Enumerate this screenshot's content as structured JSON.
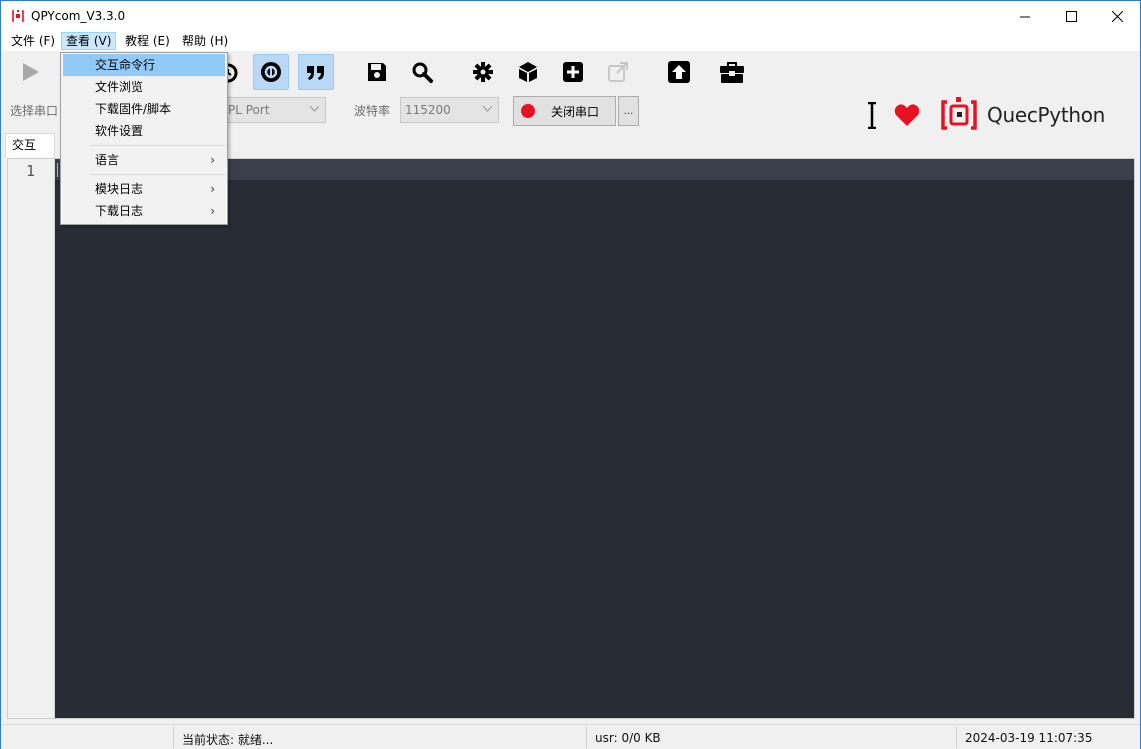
{
  "window": {
    "title": "QPYcom_V3.3.0"
  },
  "menubar": {
    "items": [
      {
        "label": "文件 (F)"
      },
      {
        "label": "查看 (V)"
      },
      {
        "label": "教程 (E)"
      },
      {
        "label": "帮助 (H)"
      }
    ]
  },
  "view_menu": {
    "items": [
      {
        "label": "交互命令行",
        "highlighted": true
      },
      {
        "label": "文件浏览"
      },
      {
        "label": "下载固件/脚本"
      },
      {
        "label": "软件设置"
      },
      {
        "label": "语言",
        "submenu": true
      },
      {
        "label": "模块日志",
        "submenu": true
      },
      {
        "label": "下载日志",
        "submenu": true
      }
    ],
    "submenu_arrow": "›"
  },
  "toolbar": {
    "icons": [
      "run-icon",
      "alarm-icon",
      "python-icon",
      "quote-icon",
      "save-icon",
      "search-icon",
      "settings-icon",
      "cube-icon",
      "plus-icon",
      "external-link-icon",
      "upload-icon",
      "toolbox-icon"
    ],
    "port_label": "选择串口",
    "port_value": "REPL Port",
    "port_value_visible": "PL Port",
    "baud_label": "波特率",
    "baud_value": "115200",
    "port_button_label": "关闭串口",
    "more_button_label": "...",
    "brand_text": "QuecPython",
    "colors": {
      "accent": "#e81123",
      "toggled": "#b7d9f5"
    }
  },
  "tabs": [
    {
      "label": "交互"
    }
  ],
  "editor": {
    "line_numbers": [
      "1"
    ],
    "background": "#282c34"
  },
  "statusbar": {
    "state": "当前状态: 就绪...",
    "usr": "usr: 0/0 KB",
    "datetime": "2024-03-19 11:07:35"
  }
}
